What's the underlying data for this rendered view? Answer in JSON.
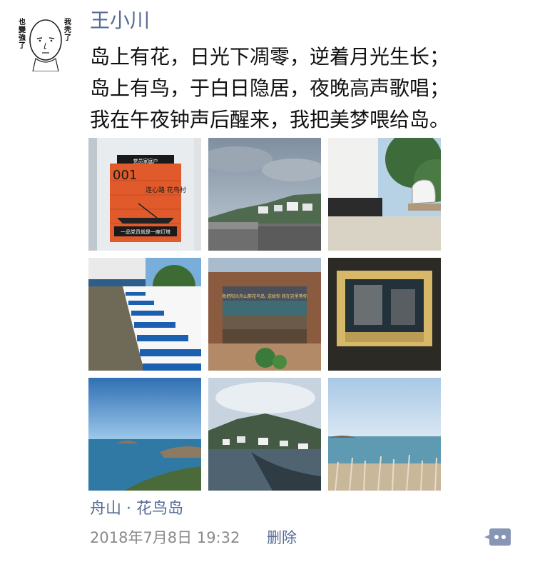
{
  "post": {
    "author": {
      "name": "王小川",
      "avatar_caption_left": "也變強了",
      "avatar_caption_right": "我秃了"
    },
    "text_lines": [
      "岛上有花，日光下凋零，逆着月光生长；",
      "岛上有鸟，于白日隐居，夜晚高声歌唱；",
      "我在午夜钟声后醒来，我把美梦喂给岛。"
    ],
    "photos": [
      {
        "subject": "orange wooden house number sign",
        "sign_number": "001",
        "sign_title": "连心路 花鸟村",
        "sign_caption": "一品党员就是一座灯塔",
        "sign_header": "党员家庭户"
      },
      {
        "subject": "cloudy sky over island village"
      },
      {
        "subject": "lighthouse base and stone marker"
      },
      {
        "subject": "white staircase with blue steps"
      },
      {
        "subject": "colorful brick wall with poem",
        "wall_text": "我把阳光舟山剪花鸟岛, 送给你 我在这里等你"
      },
      {
        "subject": "dark mural with photo"
      },
      {
        "subject": "ocean view with rocks"
      },
      {
        "subject": "harbor town under clouds"
      },
      {
        "subject": "sea view with reeds"
      }
    ],
    "location": "舟山 · 花鸟岛",
    "timestamp": "2018年7月8日 19:32",
    "delete_label": "删除",
    "comment_icon": "comment-bubble-icon"
  },
  "colors": {
    "link": "#576b95",
    "meta": "#8a8a8a",
    "text": "#111111"
  }
}
